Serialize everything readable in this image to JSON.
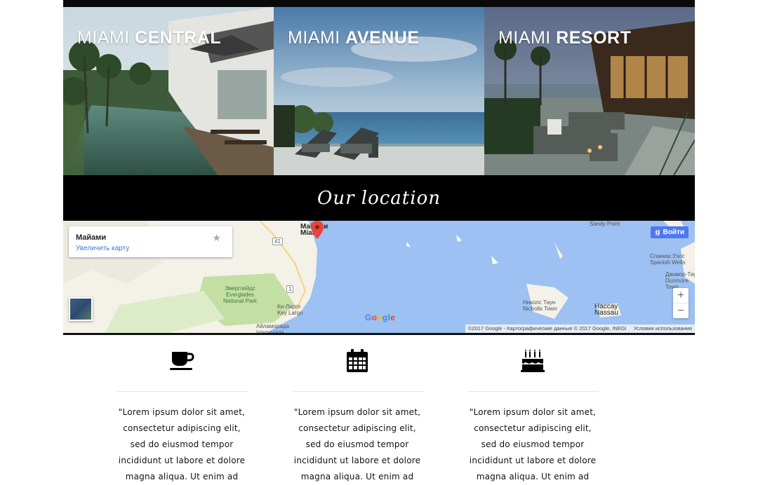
{
  "hotels": [
    {
      "city": "MIAMI",
      "name": "CENTRAL"
    },
    {
      "city": "MIAMI",
      "name": "AVENUE"
    },
    {
      "city": "MIAMI",
      "name": "RESORT"
    }
  ],
  "location": {
    "heading": "Our location"
  },
  "map": {
    "info_title": "Майами",
    "info_link": "Увеличить карту",
    "signin": "Войти",
    "zoom_in": "+",
    "zoom_out": "−",
    "logo": "Google",
    "attribution": "©2017 Google - Картографические данные © 2017 Google, INEGI",
    "terms": "Условия использования",
    "labels": {
      "miami": "Майами\nMiami",
      "everglades": "Эверглейдс\nEverglades\nNational Park",
      "key_largo": "Ки-Ларго\nKey Largo",
      "islamorada": "Айламорада\nIslamorada",
      "sandy_point": "Sandy Point",
      "spanish_wells": "Спаниш Уэлс\nSpanish Wells",
      "dunmore": "Данмор-Таун\nDunmore\nTown",
      "nicholls": "Николс Таун\nNicholls Town",
      "nassau": "Нассау\nNassau",
      "road_41": "41",
      "road_1": "1"
    }
  },
  "features": [
    {
      "icon": "coffee-cup-icon",
      "text": "\"Lorem ipsum dolor sit amet, consectetur adipiscing elit, sed do eiusmod tempor incididunt ut labore et dolore magna aliqua. Ut enim ad"
    },
    {
      "icon": "calendar-icon",
      "text": "\"Lorem ipsum dolor sit amet, consectetur adipiscing elit, sed do eiusmod tempor incididunt ut labore et dolore magna aliqua. Ut enim ad"
    },
    {
      "icon": "birthday-cake-icon",
      "text": "\"Lorem ipsum dolor sit amet, consectetur adipiscing elit, sed do eiusmod tempor incididunt ut labore et dolore magna aliqua. Ut enim ad"
    }
  ],
  "colors": {
    "band": "#000000",
    "water": "#9cc1f2",
    "land": "#f3f1e8",
    "park": "#c4dfa3",
    "pin": "#e8453c",
    "link": "#3a7bd5"
  }
}
